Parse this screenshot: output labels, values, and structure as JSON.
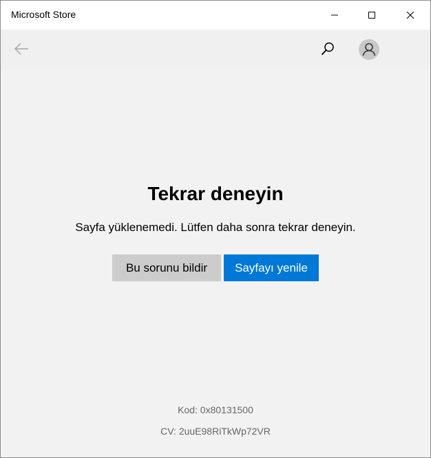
{
  "window": {
    "title": "Microsoft Store"
  },
  "icons": {
    "minimize": "minimize-icon",
    "maximize": "maximize-icon",
    "close": "close-icon",
    "back": "back-arrow-icon",
    "search": "search-icon",
    "account": "user-avatar-icon"
  },
  "error": {
    "title": "Tekrar deneyin",
    "message": "Sayfa yüklenemedi. Lütfen daha sonra tekrar deneyin.",
    "report_label": "Bu sorunu bildir",
    "refresh_label": "Sayfayı yenile",
    "code": "Kod: 0x80131500",
    "cv": "CV: 2uuE98RiTkWp72VR"
  },
  "colors": {
    "accent": "#0078d7",
    "secondary_button": "#cccccc",
    "background": "#f2f2f2",
    "muted_text": "#666666"
  }
}
